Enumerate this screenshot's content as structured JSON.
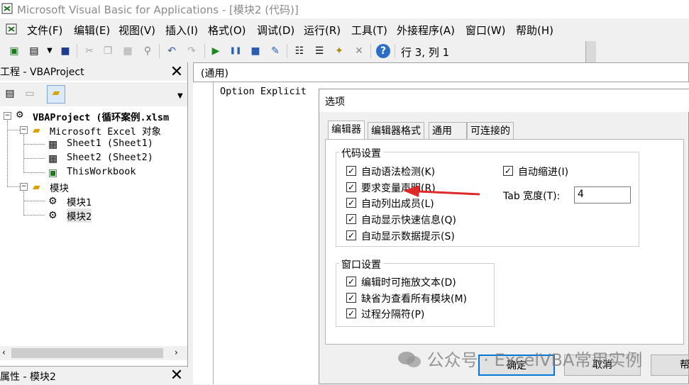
{
  "window": {
    "title": "Microsoft Visual Basic for Applications - [模块2 (代码)]"
  },
  "menu": [
    "文件(F)",
    "编辑(E)",
    "视图(V)",
    "插入(I)",
    "格式(O)",
    "调试(D)",
    "运行(R)",
    "工具(T)",
    "外接程序(A)",
    "窗口(W)",
    "帮助(H)"
  ],
  "toolbar": {
    "position": "行 3, 列 1"
  },
  "project": {
    "title": "工程 - VBAProject",
    "root": "VBAProject (循环案例.xlsm",
    "excel_objects": "Microsoft Excel 对象",
    "sheet1": "Sheet1 (Sheet1)",
    "sheet2": "Sheet2 (Sheet2)",
    "workbook": "ThisWorkbook",
    "modules": "模块",
    "module1": "模块1",
    "module2": "模块2"
  },
  "properties": {
    "title": "属性 - 模块2"
  },
  "code": {
    "object_combo": "(通用)",
    "line1": "Option Explicit"
  },
  "dialog": {
    "title": "选项",
    "tabs": [
      "编辑器",
      "编辑器格式",
      "通用",
      "可连接的"
    ],
    "code_group": "代码设置",
    "auto_syntax": "自动语法检测(K)",
    "require_var": "要求变量声明(R)",
    "auto_list": "自动列出成员(L)",
    "auto_quickinfo": "自动显示快速信息(Q)",
    "auto_datatips": "自动显示数据提示(S)",
    "auto_indent": "自动缩进(I)",
    "tab_width_label": "Tab 宽度(T):",
    "tab_width_value": "4",
    "window_group": "窗口设置",
    "drag_drop": "编辑时可拖放文本(D)",
    "full_module": "缺省为查看所有模块(M)",
    "proc_sep": "过程分隔符(P)",
    "ok": "确定",
    "cancel": "取消",
    "help": "帮"
  },
  "watermark": "公众号 · ExcelVBA常用实例"
}
